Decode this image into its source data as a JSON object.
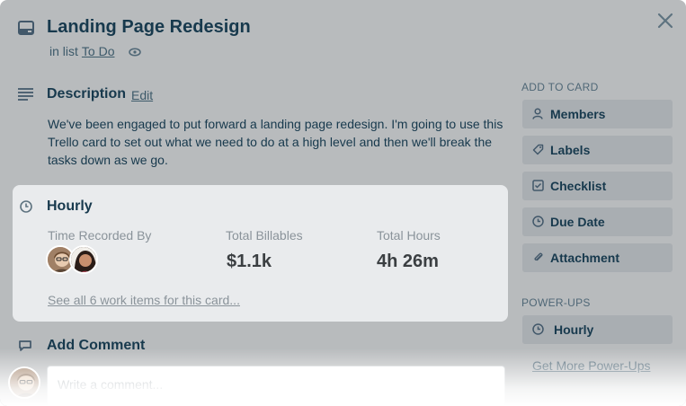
{
  "card": {
    "title": "Landing Page Redesign",
    "in_list_prefix": "in list",
    "list_name": "To Do"
  },
  "description": {
    "heading": "Description",
    "edit_label": "Edit",
    "text": "We've been engaged to put forward a landing page redesign. I'm going to use this Trello card to set out what we need to do at a high level and then we'll break the tasks down as we go."
  },
  "hourly": {
    "heading": "Hourly",
    "time_recorded_label": "Time Recorded By",
    "total_billables_label": "Total Billables",
    "total_billables_value": "$1.1k",
    "total_hours_label": "Total Hours",
    "total_hours_value": "4h 26m",
    "see_all_link": "See all 6 work items for this card..."
  },
  "comment": {
    "heading": "Add Comment",
    "placeholder": "Write a comment..."
  },
  "sidebar": {
    "add_to_card_heading": "ADD TO CARD",
    "buttons": [
      {
        "label": "Members",
        "icon": "person-icon"
      },
      {
        "label": "Labels",
        "icon": "tag-icon"
      },
      {
        "label": "Checklist",
        "icon": "checkbox-icon"
      },
      {
        "label": "Due Date",
        "icon": "clock-icon"
      },
      {
        "label": "Attachment",
        "icon": "paperclip-icon"
      }
    ],
    "powerups_heading": "POWER-UPS",
    "powerups": [
      {
        "label": "Hourly",
        "icon": "clock-icon"
      }
    ],
    "get_more_link": "Get More Power-Ups"
  },
  "colors": {
    "overlay_bg": "#b8bbbd",
    "panel_bg": "#e9ebed",
    "button_bg": "#a9aeb2",
    "title_text": "#17394d"
  }
}
